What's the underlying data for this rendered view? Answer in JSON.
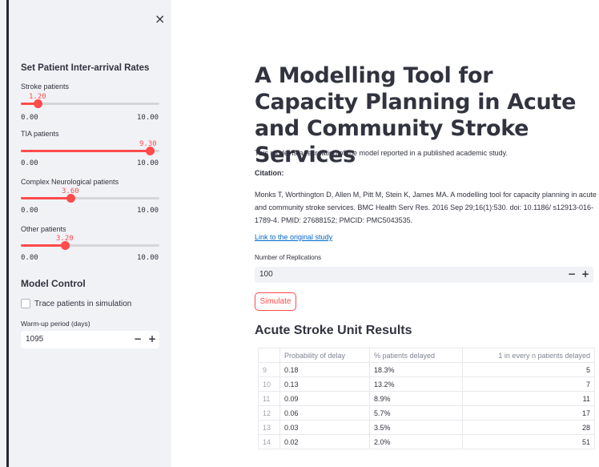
{
  "sidebar": {
    "close_icon": "×",
    "rates_heading": "Set Patient Inter-arrival Rates",
    "sliders": [
      {
        "label": "Stroke patients",
        "value": "1.20",
        "fraction": 0.12,
        "min": "0.00",
        "max": "10.00"
      },
      {
        "label": "TIA patients",
        "value": "9.30",
        "fraction": 0.93,
        "min": "0.00",
        "max": "10.00"
      },
      {
        "label": "Complex Neurological patients",
        "value": "3.60",
        "fraction": 0.36,
        "min": "0.00",
        "max": "10.00"
      },
      {
        "label": "Other patients",
        "value": "3.20",
        "fraction": 0.32,
        "min": "0.00",
        "max": "10.00"
      }
    ],
    "model_control_heading": "Model Control",
    "trace_label": "Trace patients in simulation",
    "warmup_label": "Warm-up period (days)",
    "warmup_value": "1095",
    "minus": "−",
    "plus": "+"
  },
  "main": {
    "title": "A Modelling Tool for Capacity Planning in Acute and Community Stroke Services",
    "intro": "This model is a recreation of the model reported in a published academic study.",
    "citation_heading": "Citation:",
    "citation_text": "Monks T, Worthington D, Allen M, Pitt M, Stein K, James MA. A modelling tool for capacity planning in acute and community stroke services. BMC Health Serv Res. 2016 Sep 29;16(1):530. doi: 10.1186/ s12913-016-1789-4. PMID: 27688152; PMCID: PMC5043535.",
    "link_text": "Link to the original study",
    "replications_label": "Number of Replications",
    "replications_value": "100",
    "minus": "−",
    "plus": "+",
    "simulate_label": "Simulate",
    "results_heading": "Acute Stroke Unit Results",
    "table": {
      "columns": [
        "",
        "Probability of delay",
        "% patients delayed",
        "1 in every n patients delayed"
      ],
      "rows": [
        [
          "9",
          "0.18",
          "18.3%",
          "5"
        ],
        [
          "10",
          "0.13",
          "13.2%",
          "7"
        ],
        [
          "11",
          "0.09",
          "8.9%",
          "11"
        ],
        [
          "12",
          "0.06",
          "5.7%",
          "17"
        ],
        [
          "13",
          "0.03",
          "3.5%",
          "28"
        ],
        [
          "14",
          "0.02",
          "2.0%",
          "51"
        ]
      ]
    }
  },
  "colors": {
    "accent": "#ff4b4b",
    "sidebar_bg": "#f0f2f6",
    "link": "#0068c9"
  }
}
